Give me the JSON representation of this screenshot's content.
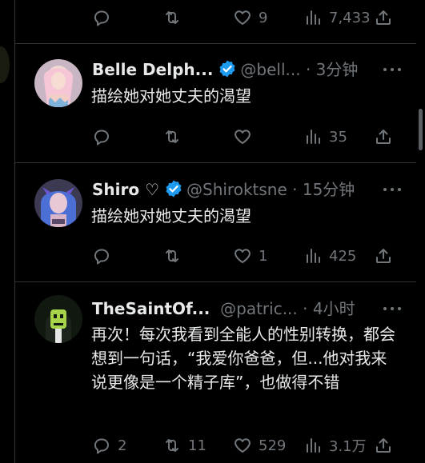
{
  "top_actions": {
    "replies": "",
    "retweets": "",
    "likes": "9",
    "views": "7,433"
  },
  "tweets": [
    {
      "name": "Belle Delph...",
      "handle": "@bell...",
      "time": "· 3分钟",
      "text": "描绘她对她丈夫的渴望",
      "replies": "",
      "retweets": "",
      "likes": "",
      "views": "35",
      "verified": true
    },
    {
      "name": "Shiro ♡",
      "handle": "@Shiroktsne",
      "time": "· 15分钟",
      "text": "描绘她对她丈夫的渴望",
      "replies": "",
      "retweets": "",
      "likes": "1",
      "views": "425",
      "verified": true
    },
    {
      "name": "TheSaintOf...",
      "handle": "@patric...",
      "time": "· 4小时",
      "text": "再次！每次我看到全能人的性别转换，都会想到一句话，“我爱你爸爸，但...他对我来说更像是一个精子库”，也做得不错",
      "replies": "2",
      "retweets": "11",
      "likes": "529",
      "views": "3.1万",
      "verified": false
    }
  ],
  "colors": {
    "background": "#000000",
    "text": "#e7e9ea",
    "muted": "#71767b",
    "divider": "#2f3336",
    "verified": "#1d9bf0"
  }
}
